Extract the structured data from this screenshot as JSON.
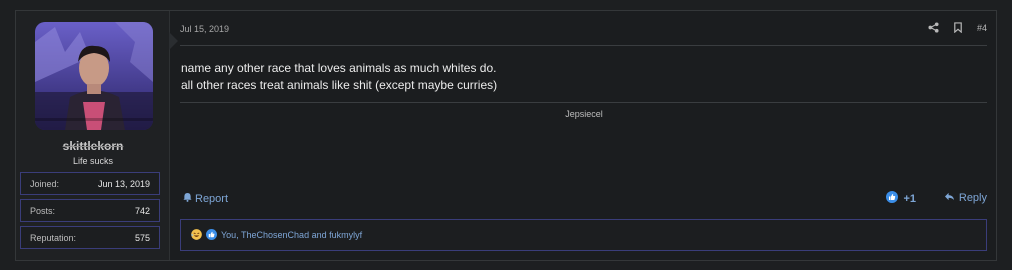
{
  "post": {
    "date": "Jul 15, 2019",
    "number": "#4",
    "message_lines": [
      "name any other race that loves animals as much whites do.",
      "all other races treat animals like shit (except maybe curries)"
    ],
    "signature": "Jepsiecel"
  },
  "user": {
    "username": "skittlekorn",
    "title": "Life sucks",
    "stats": [
      {
        "label": "Joined:",
        "value": "Jun 13, 2019"
      },
      {
        "label": "Posts:",
        "value": "742"
      },
      {
        "label": "Reputation:",
        "value": "575"
      }
    ]
  },
  "footer": {
    "report_label": "Report",
    "like_count": "+1",
    "reply_label": "Reply"
  },
  "reactions": {
    "text": "You, TheChosenChad and fukmylyf"
  },
  "icons": [
    "share-icon",
    "bookmark-icon",
    "bell-icon",
    "like-icon",
    "reply-arrow-icon",
    "laugh-emoji-icon"
  ],
  "colors": {
    "link": "#7ea6d6",
    "like_blue": "#3b8ee8",
    "border_accent": "#3a3d7a"
  }
}
